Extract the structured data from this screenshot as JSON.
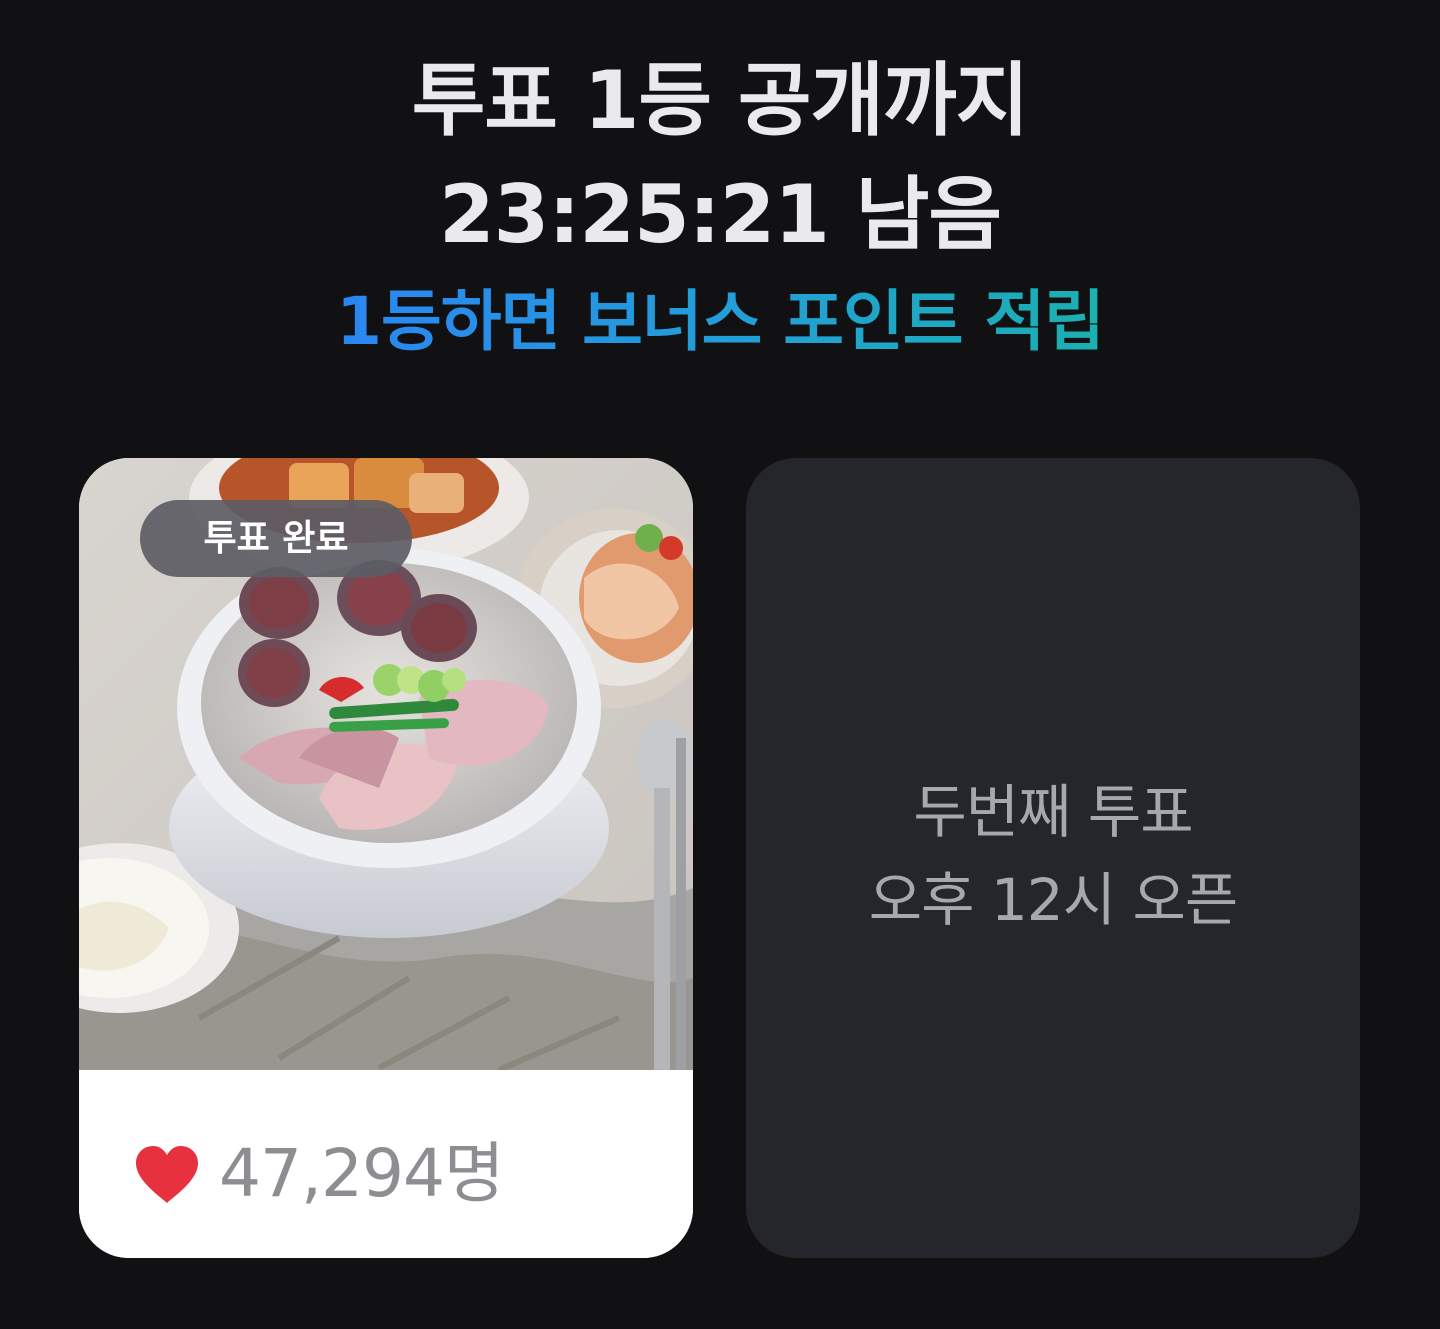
{
  "header": {
    "title_line1": "투표 1등 공개까지",
    "title_line2": "23:25:21 남음",
    "subtitle": "1등하면 보너스 포인트 적립"
  },
  "cards": [
    {
      "state": "voted",
      "badge": "투표 완료",
      "image_subject": "순대국",
      "vote_count": "47,294명",
      "icon": "heart-icon"
    },
    {
      "state": "upcoming",
      "line1": "두번째 투표",
      "line2": "오후 12시 오픈"
    }
  ],
  "colors": {
    "background": "#111113",
    "card_upcoming": "#25262c",
    "accent_start": "#2a86f2",
    "accent_end": "#1bb0b0",
    "heart": "#e8313f",
    "badge": "#5c5c64"
  }
}
